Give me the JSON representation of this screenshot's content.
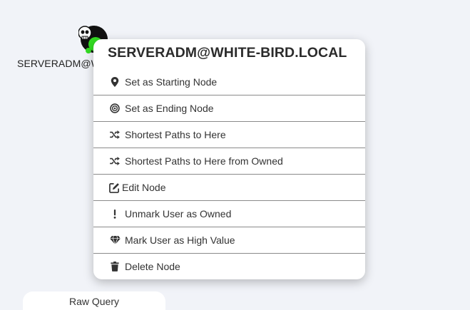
{
  "node": {
    "label": "SERVERADM@WHITE-BIRD.LOCAL",
    "icon": "skull-icon",
    "owned_color": "#33dd22"
  },
  "context_menu": {
    "title": "SERVERADM@WHITE-BIRD.LOCAL",
    "items": [
      {
        "label": "Set as Starting Node",
        "icon": "map-marker-icon"
      },
      {
        "label": "Set as Ending Node",
        "icon": "bullseye-icon"
      },
      {
        "label": "Shortest Paths to Here",
        "icon": "random-icon"
      },
      {
        "label": "Shortest Paths to Here from Owned",
        "icon": "random-icon"
      },
      {
        "label": "Edit Node",
        "icon": "edit-icon"
      },
      {
        "label": "Unmark User as Owned",
        "icon": "exclamation-icon"
      },
      {
        "label": "Mark User as High Value",
        "icon": "gem-icon"
      },
      {
        "label": "Delete Node",
        "icon": "trash-icon"
      }
    ]
  },
  "raw_query": {
    "label": "Raw Query"
  }
}
